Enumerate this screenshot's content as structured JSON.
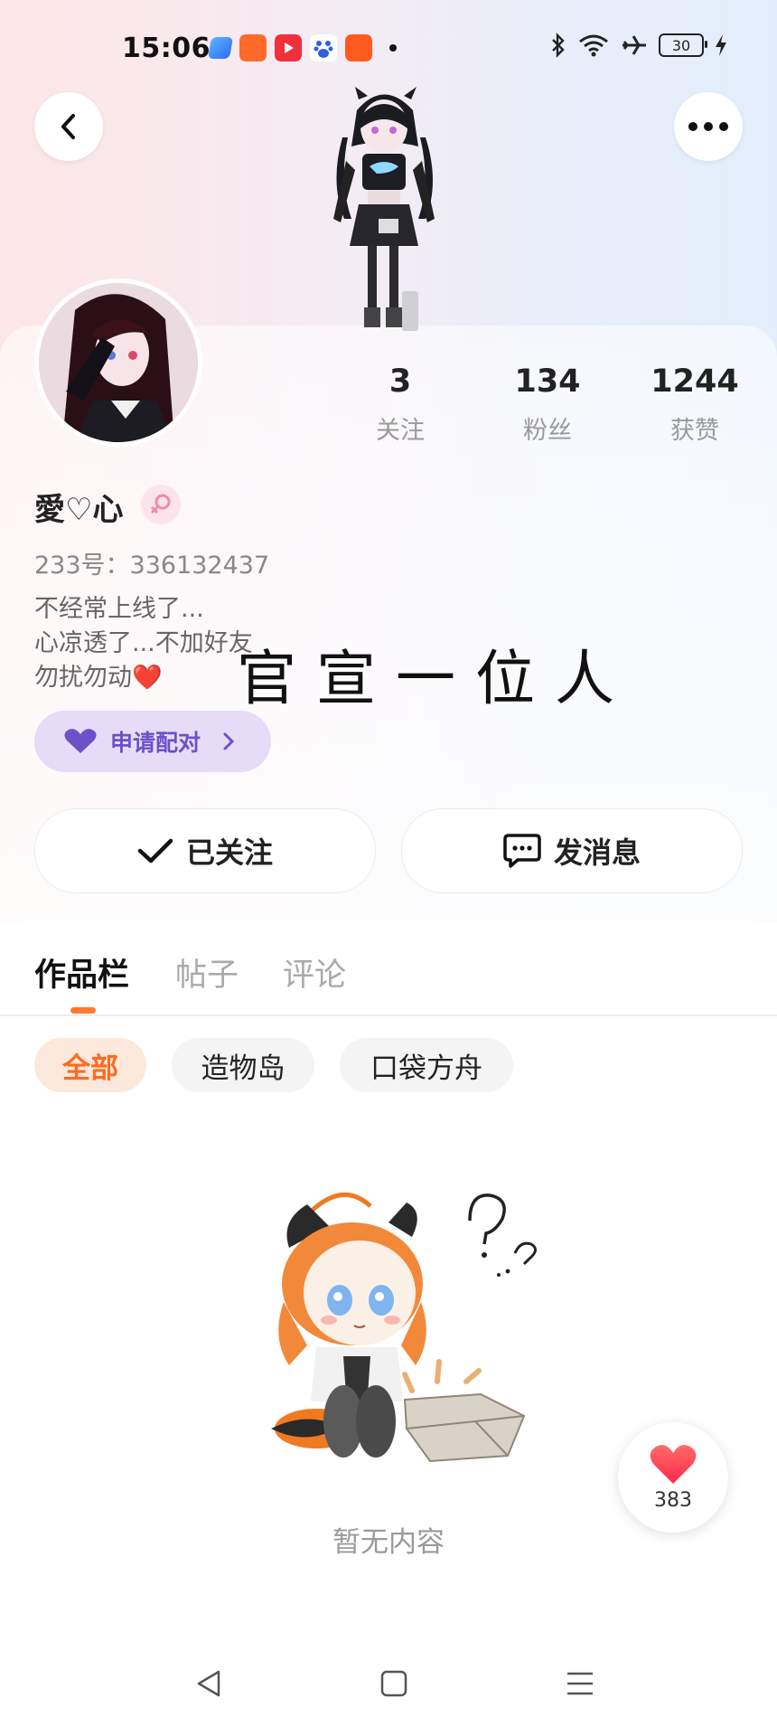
{
  "status_bar": {
    "time": "15:06",
    "battery": "30"
  },
  "header": {
    "back_icon": "chevron-left-icon",
    "more_icon": "more-dots-icon"
  },
  "profile": {
    "name": "愛♡心",
    "gender_icon": "female-icon",
    "uid": "233号：336132437",
    "bio_lines": [
      "不经常上线了...",
      "心凉透了...不加好友",
      "勿扰勿动❤️"
    ],
    "overlay_text": "官宣一位人",
    "pair_button": "申请配对"
  },
  "stats": [
    {
      "num": "3",
      "label": "关注"
    },
    {
      "num": "134",
      "label": "粉丝"
    },
    {
      "num": "1244",
      "label": "获赞"
    }
  ],
  "actions": {
    "follow": "已关注",
    "message": "发消息"
  },
  "tabs": [
    "作品栏",
    "帖子",
    "评论"
  ],
  "filters": [
    "全部",
    "造物岛",
    "口袋方舟"
  ],
  "empty_text": "暂无内容",
  "like_fab": {
    "count": "383"
  },
  "colors": {
    "accent": "#ff7a2f",
    "pair": "#6b52c8",
    "like": "#ff3b4f"
  }
}
